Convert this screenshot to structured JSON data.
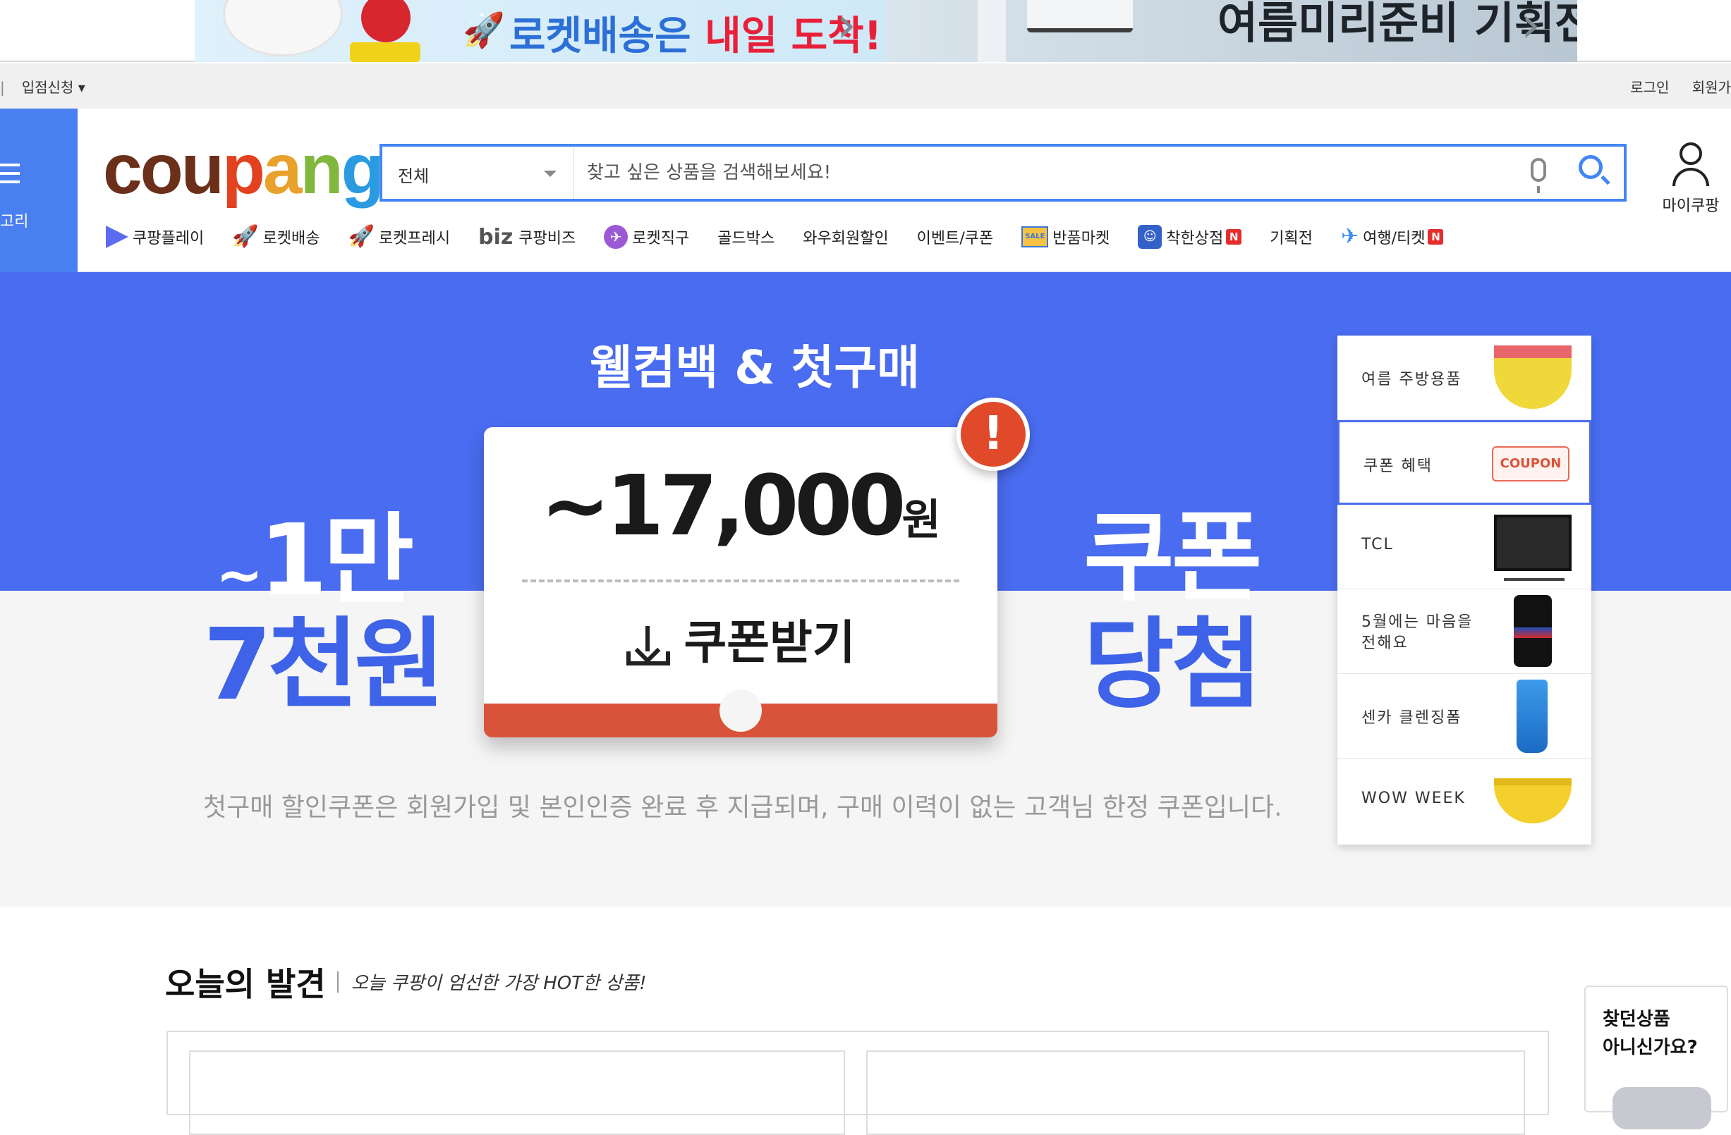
{
  "promo": {
    "left_text_a": "로켓배송은",
    "left_text_b": "내일 도착!",
    "right_text": "여름미리준비 기획전",
    "chevron": "›"
  },
  "utility_bar": {
    "left_separator": "|",
    "seller_signup": "입점신청",
    "login": "로그인",
    "signup": "회원가"
  },
  "header": {
    "category_label": "고리",
    "logo_text": "coupang",
    "logo_colors": [
      "#6b2f1a",
      "#6b2f1a",
      "#6b2f1a",
      "#e2421f",
      "#e8a12a",
      "#80b73d",
      "#2a9be0"
    ],
    "search": {
      "category": "전체",
      "placeholder": "찾고 싶은 상품을 검색해보세요!"
    },
    "mycoupang_label": "마이쿠팡"
  },
  "nav": {
    "items": [
      {
        "label": "쿠팡플레이",
        "icon": "play-icon"
      },
      {
        "label": "로켓배송",
        "icon": "rocket-icon"
      },
      {
        "label": "로켓프레시",
        "icon": "rocket-fresh-icon"
      },
      {
        "label": "쿠팡비즈",
        "icon": "biz-icon",
        "prefix": "biz"
      },
      {
        "label": "로켓직구",
        "icon": "rocket-direct-icon"
      },
      {
        "label": "골드박스"
      },
      {
        "label": "와우회원할인"
      },
      {
        "label": "이벤트/쿠폰"
      },
      {
        "label": "반품마켓",
        "icon": "sale-market-icon"
      },
      {
        "label": "착한상점",
        "icon": "good-store-icon",
        "badge": "N"
      },
      {
        "label": "기획전"
      },
      {
        "label": "여행/티켓",
        "icon": "plane-icon",
        "badge": "N"
      }
    ]
  },
  "hero": {
    "title": "웰컴백 & 첫구매",
    "amount_line1_tilde": "~",
    "amount_line1": "1만",
    "amount_line2": "7천원",
    "coupon_value": "~17,000",
    "coupon_unit": "원",
    "coupon_button": "쿠폰받기",
    "alert_mark": "!",
    "word_line1": "쿠폰",
    "word_line2": "당첨",
    "note": "첫구매 할인쿠폰은 회원가입 및 본인인증 완료 후 지급되며, 구매 이력이 없는 고객님 한정 쿠폰입니다.",
    "colors": {
      "top": "#4a6cf0",
      "accent_text": "#3e63e8",
      "coupon_foot": "#d9533a"
    }
  },
  "side_panel": {
    "items": [
      {
        "label": "여름 주방용품",
        "thumb": "bowl"
      },
      {
        "label": "쿠폰 혜택",
        "thumb": "coupon",
        "thumb_text": "COUPON",
        "active": true
      },
      {
        "label": "TCL",
        "thumb": "tv"
      },
      {
        "label": "5월에는 마음을 전해요",
        "thumb": "can"
      },
      {
        "label": "센카 클렌징폼",
        "thumb": "tube"
      },
      {
        "label": "WOW WEEK",
        "thumb": "banana"
      }
    ]
  },
  "today": {
    "title": "오늘의 발견",
    "subtitle": "오늘 쿠팡이 엄선한 가장 HOT한 상품!"
  },
  "help": {
    "line1": "찾던상품",
    "line2": "아니신가요?"
  }
}
